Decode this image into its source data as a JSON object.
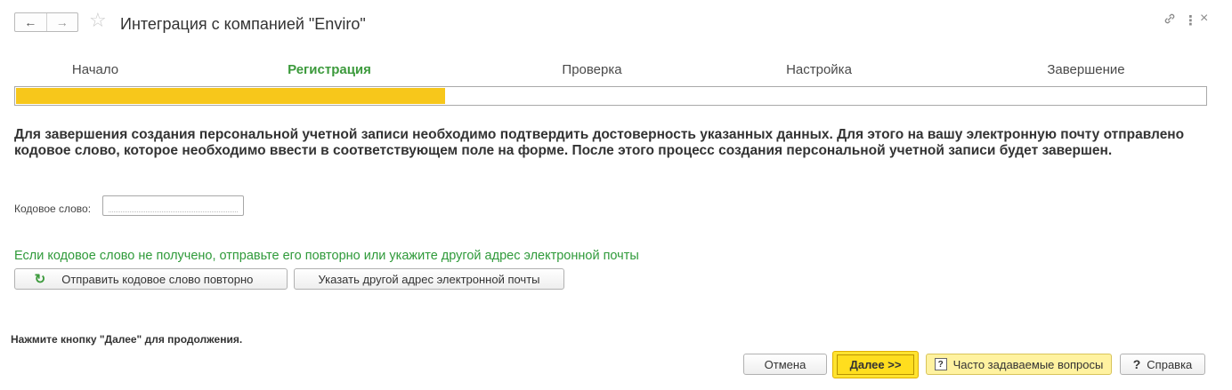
{
  "window": {
    "title": "Интеграция с компанией \"Enviro\"",
    "back_icon": "←",
    "forward_icon": "→",
    "favorite_icon": "☆",
    "link_icon": "🔗",
    "more_icon": "⋮",
    "close_icon": "×"
  },
  "steps": [
    {
      "label": "Начало"
    },
    {
      "label": "Регистрация"
    },
    {
      "label": "Проверка"
    },
    {
      "label": "Настройка"
    },
    {
      "label": "Завершение"
    }
  ],
  "active_step": "Регистрация",
  "progress": {
    "fraction": 0.361
  },
  "message": "Для завершения создания персональной учетной записи необходимо подтвердить достоверность указанных данных. Для этого на вашу электронную почту отправлено кодовое слово, которое необходимо ввести в соответствующем поле на форме. После этого процесс создания персональной учетной записи будет завершен.",
  "code_field": {
    "label": "Кодовое слово:",
    "value": ""
  },
  "hint": "Если кодовое слово не получено, отправьте его повторно или укажите другой адрес электронной почты",
  "buttons": {
    "resend": "Отправить кодовое слово повторно",
    "resend_icon": "↻",
    "other_email": "Указать другой адрес электронной почты",
    "cancel": "Отмена",
    "next": "Далее >>",
    "faq": "Часто задаваемые вопросы",
    "faq_icon": "?",
    "help": "Справка",
    "help_icon": "?"
  },
  "footer_note": "Нажмите кнопку \"Далее\" для продолжения.",
  "colors": {
    "progress_fill": "#f7c71b",
    "active_step": "#3c9a3c",
    "hint": "#2f9a3a",
    "next_button": "#ffe32f"
  }
}
